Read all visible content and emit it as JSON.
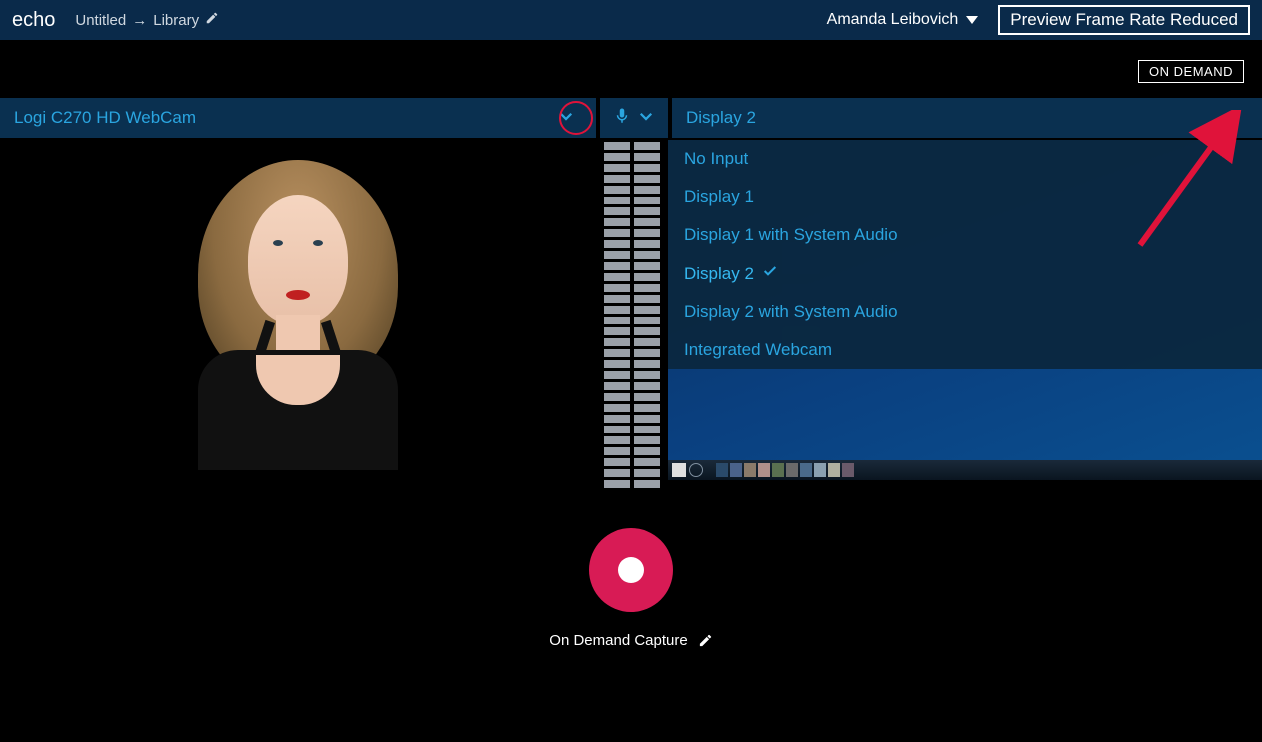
{
  "header": {
    "logo": "echo",
    "breadcrumb_from": "Untitled",
    "breadcrumb_arrow": "→",
    "breadcrumb_to": "Library",
    "username": "Amanda Leibovich",
    "framerate_notice": "Preview Frame Rate Reduced"
  },
  "badge": {
    "ondemand": "ON DEMAND"
  },
  "sources": {
    "camera_label": "Logi C270 HD WebCam",
    "display_label": "Display 2",
    "display_dropdown": [
      {
        "label": "No Input",
        "selected": false
      },
      {
        "label": "Display 1",
        "selected": false
      },
      {
        "label": "Display 1 with System Audio",
        "selected": false
      },
      {
        "label": "Display 2",
        "selected": true
      },
      {
        "label": "Display 2 with System Audio",
        "selected": false
      },
      {
        "label": "Integrated Webcam",
        "selected": false
      }
    ]
  },
  "record": {
    "capture_label": "On Demand Capture"
  }
}
